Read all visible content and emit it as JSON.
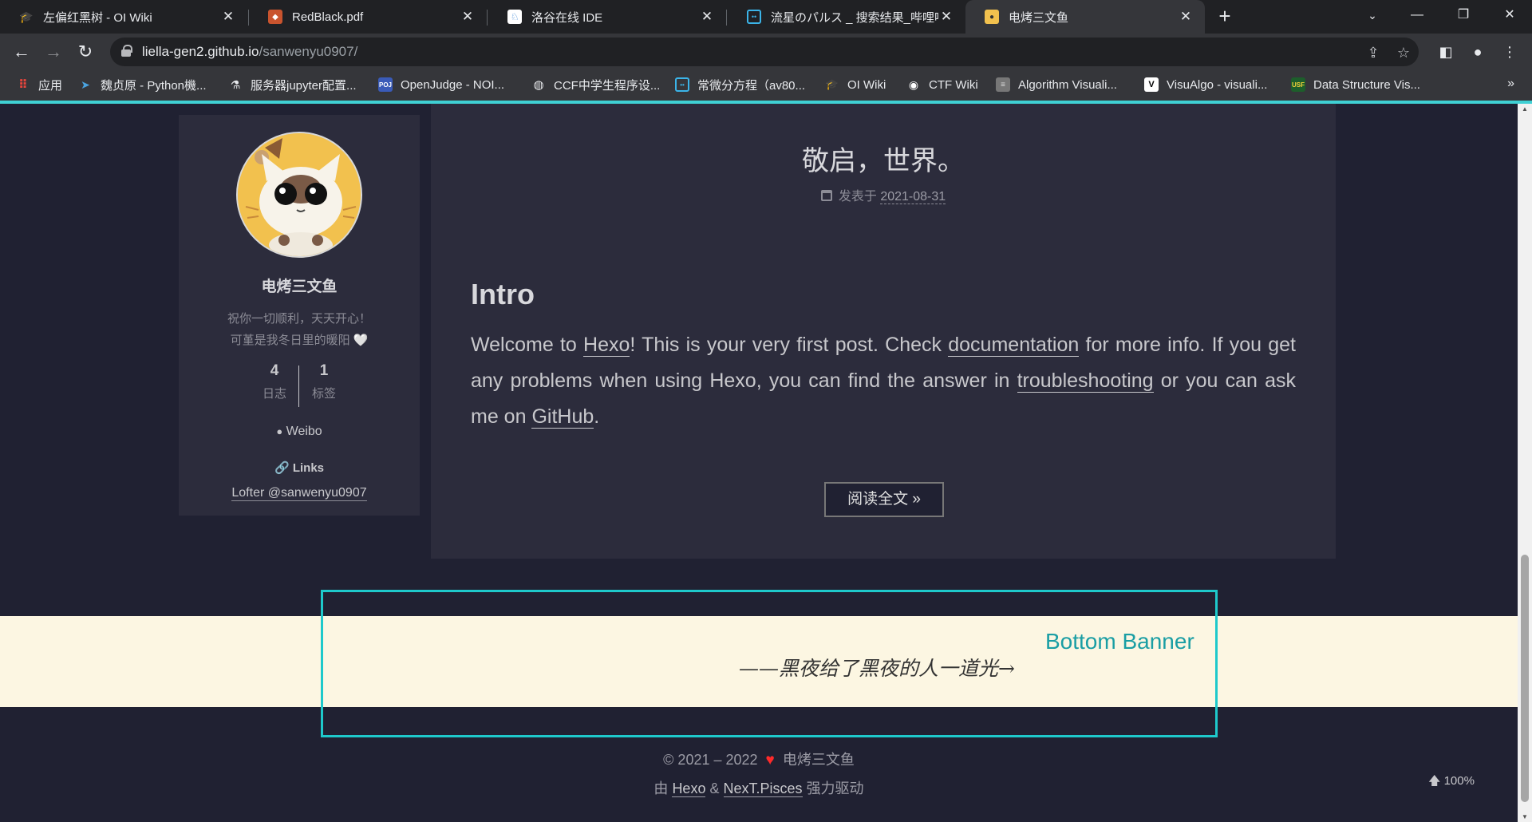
{
  "browser": {
    "tabs": [
      {
        "title": "左偏红黑树 - OI Wiki",
        "icon": "oiwiki-icon"
      },
      {
        "title": "RedBlack.pdf",
        "icon": "shield-pdf-icon"
      },
      {
        "title": "洛谷在线 IDE",
        "icon": "luogu-icon"
      },
      {
        "title": "流星のパルス _ 搜索结果_哔哩哔",
        "icon": "bilibili-icon"
      },
      {
        "title": "电烤三文鱼",
        "icon": "avatar-icon"
      }
    ],
    "url_host": "liella-gen2.github.io",
    "url_path": "/sanwenyu0907/",
    "bookmarks": [
      {
        "label": "应用",
        "icon": "apps-grid-icon"
      },
      {
        "label": "魏贞原 - Python機...",
        "icon": "bird-icon"
      },
      {
        "label": "服务器jupyter配置...",
        "icon": "flask-icon"
      },
      {
        "label": "OpenJudge - NOI...",
        "icon": "poj-icon"
      },
      {
        "label": "CCF中学生程序设...",
        "icon": "globe-icon"
      },
      {
        "label": "常微分方程（av80...",
        "icon": "bilibili-icon"
      },
      {
        "label": "OI Wiki",
        "icon": "oiwiki-icon"
      },
      {
        "label": "CTF Wiki",
        "icon": "ctf-icon"
      },
      {
        "label": "Algorithm Visuali...",
        "icon": "algo-icon"
      },
      {
        "label": "VisuAlgo - visuali...",
        "icon": "visualgo-icon"
      },
      {
        "label": "Data Structure Vis...",
        "icon": "usf-icon"
      }
    ],
    "bookmarks_more": "»"
  },
  "sidebar": {
    "author": "电烤三文鱼",
    "description_1": "祝你一切顺利，天天开心！",
    "description_2": "可堇是我冬日里的暖阳 🤍",
    "stats": [
      {
        "count": "4",
        "label": "日志"
      },
      {
        "count": "1",
        "label": "标签"
      }
    ],
    "social": "Weibo",
    "links_title": "Links",
    "links": [
      "Lofter @sanwenyu0907"
    ]
  },
  "post": {
    "title": "敬启，世界。",
    "meta_prefix": "发表于",
    "date": "2021-08-31",
    "heading": "Intro",
    "body": [
      {
        "text": "Welcome to "
      },
      {
        "link": "Hexo"
      },
      {
        "text": "! This is your very first post. Check "
      },
      {
        "link": "documentation"
      },
      {
        "text": " for more info. If you get any problems when using Hexo, you can find the answer in "
      },
      {
        "link": "troubleshooting"
      },
      {
        "text": " or you can ask me on "
      },
      {
        "link": "GitHub"
      },
      {
        "text": "."
      }
    ],
    "read_more": "阅读全文 »"
  },
  "banner": {
    "label": "Bottom Banner",
    "quote": "——黑夜给了黑夜的人一道光→"
  },
  "footer": {
    "copyright": "© 2021 – 2022",
    "owner": "电烤三文鱼",
    "powered_prefix": "由",
    "hexo": "Hexo",
    "amp": "&",
    "theme": "NexT.Pisces",
    "powered_suffix": "强力驱动",
    "progress": "100%"
  }
}
